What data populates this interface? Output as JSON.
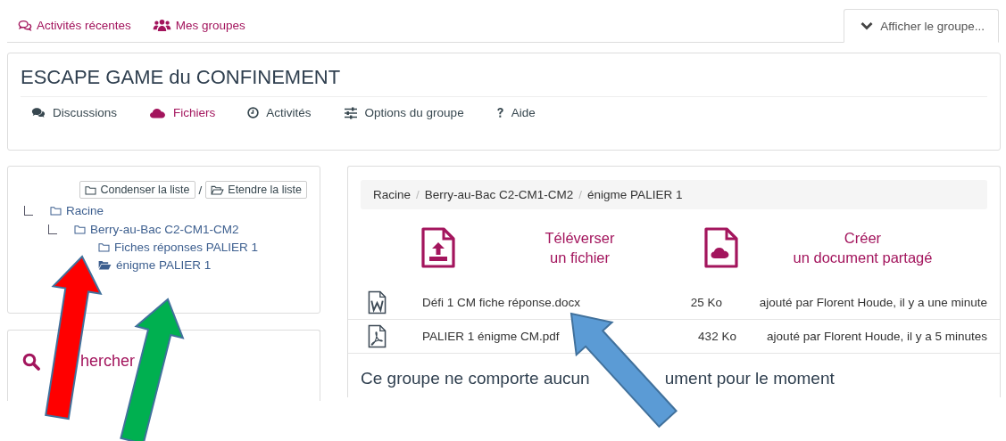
{
  "top_tabs": [
    {
      "label": "Activités récentes"
    },
    {
      "label": "Mes groupes"
    }
  ],
  "group_toggle": {
    "label": "Afficher le groupe..."
  },
  "group": {
    "title": "ESCAPE GAME du CONFINEMENT",
    "nav": [
      {
        "label": "Discussions",
        "selected": false
      },
      {
        "label": "Fichiers",
        "selected": true
      },
      {
        "label": "Activités",
        "selected": false
      },
      {
        "label": "Options du groupe",
        "selected": false
      },
      {
        "label": "Aide",
        "selected": false
      }
    ]
  },
  "tree": {
    "buttons": [
      {
        "label": "Condenser la liste"
      },
      {
        "label": "Etendre la liste"
      }
    ],
    "separator": "/",
    "items": [
      {
        "label": "Racine",
        "selected": false,
        "children": [
          {
            "label": "Berry-au-Bac C2-CM1-CM2",
            "selected": false,
            "children": [
              {
                "label": "Fiches réponses PALIER 1",
                "selected": false
              },
              {
                "label": "énigme PALIER 1",
                "selected": true
              }
            ]
          }
        ]
      }
    ]
  },
  "search": {
    "title": "hercher"
  },
  "files": {
    "breadcrumb": [
      {
        "label": "Racine"
      },
      {
        "separator": "/",
        "label": "Berry-au-Bac C2-CM1-CM2"
      },
      {
        "separator": "/",
        "label": "énigme PALIER 1"
      }
    ],
    "actions": [
      {
        "label": "Téléverser",
        "label2": "un fichier"
      },
      {
        "label": "Créer",
        "label2": "un document partagé"
      }
    ],
    "rows": [
      {
        "kind": "word",
        "name": "Défi 1 CM fiche réponse.docx",
        "size": "25 Ko",
        "added": "ajouté par Florent Houde, il y a une minute"
      },
      {
        "kind": "pdf",
        "name": "PALIER 1 énigme CM.pdf",
        "size": "432 Ko",
        "added": "ajouté par Florent Houde, il y a 5 minutes"
      }
    ],
    "empty_message": [
      "Ce groupe ne comporte aucun",
      "ument pour le moment"
    ]
  },
  "annotations": [
    {
      "kind": "arrow",
      "color": "#ff0000"
    },
    {
      "kind": "arrow",
      "color": "#00b050"
    },
    {
      "kind": "arrow",
      "color": "#5b9bd5"
    }
  ]
}
